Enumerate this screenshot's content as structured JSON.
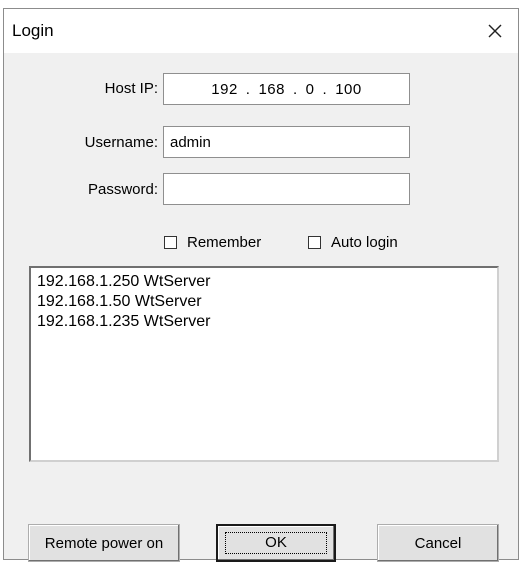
{
  "window": {
    "title": "Login",
    "close_icon": "close-icon"
  },
  "form": {
    "host_ip_label": "Host IP:",
    "host_ip": [
      "192",
      "168",
      "0",
      "100"
    ],
    "host_ip_separator": ".",
    "username_label": "Username:",
    "username_value": "admin",
    "password_label": "Password:",
    "password_value": ""
  },
  "options": {
    "remember_label": "Remember",
    "remember_checked": false,
    "auto_login_label": "Auto login",
    "auto_login_checked": false
  },
  "server_list": {
    "items": [
      "192.168.1.250 WtServer",
      "192.168.1.50 WtServer",
      "192.168.1.235 WtServer"
    ]
  },
  "buttons": {
    "remote_power_on": "Remote power on",
    "ok": "OK",
    "cancel": "Cancel"
  }
}
